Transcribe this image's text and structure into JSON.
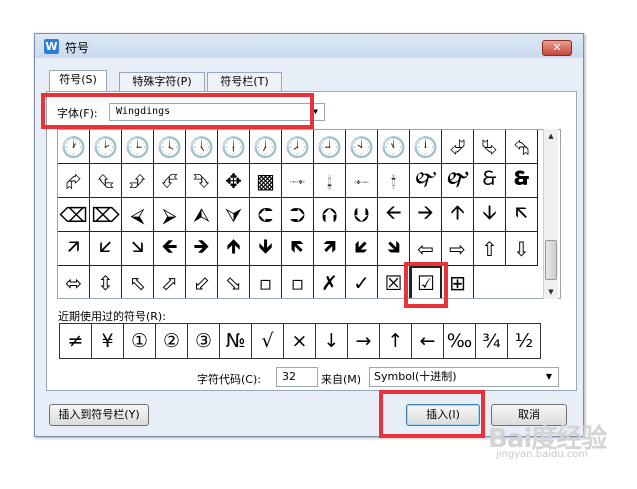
{
  "window": {
    "title": "符号",
    "app_icon": "W",
    "close": "✕"
  },
  "tabs": [
    {
      "label": "符号(S)"
    },
    {
      "label": "特殊字符(P)"
    },
    {
      "label": "符号栏(T)"
    }
  ],
  "font": {
    "label": "字体(F):",
    "value": "Wingdings",
    "arrow": "▼"
  },
  "symbols": [
    "🕐",
    "🕑",
    "🕒",
    "🕓",
    "🕔",
    "🕕",
    "🕖",
    "🕗",
    "🕘",
    "🕙",
    "🕚",
    "🕛",
    "⮰",
    "⮱",
    "⮲",
    "⮳",
    "⮴",
    "⮵",
    "⮶",
    "⮷",
    "✥",
    "▩",
    "🙬",
    "🙭",
    "🙮",
    "🙯",
    "🙰",
    "🙱",
    "🙲",
    "🙳",
    "⌫",
    "⌦",
    "⮘",
    "⮚",
    "⮙",
    "⮛",
    "⮈",
    "⮊",
    "⮉",
    "⮋",
    "🡨",
    "🡪",
    "🡩",
    "🡫",
    "🡬",
    "🡭",
    "🡯",
    "🡮",
    "🡸",
    "🡺",
    "🡹",
    "🡻",
    "🡼",
    "🡽",
    "🡿",
    "🡾",
    "⇦",
    "⇨",
    "⇧",
    "⇩",
    "⬄",
    "⇳",
    "⬁",
    "⬀",
    "⬃",
    "⬂",
    "▫",
    "▫",
    "✗",
    "✓",
    "☒",
    "☑",
    "⊞",
    "",
    ""
  ],
  "recent": {
    "label": "近期使用过的符号(R):",
    "items": [
      "≠",
      "¥",
      "①",
      "②",
      "③",
      "№",
      "√",
      "×",
      "↓",
      "→",
      "↑",
      "←",
      "‰",
      "¾",
      "½"
    ]
  },
  "char_code": {
    "label": "字符代码(C):",
    "value": "32"
  },
  "from": {
    "label": "来自(M)",
    "value": "Symbol(十进制)",
    "arrow": "▼"
  },
  "buttons": {
    "insert_to_bar": "插入到符号栏(Y)",
    "insert": "插入(I)",
    "cancel": "取消"
  },
  "scrollbar": {
    "up": "▲",
    "down": "▼"
  },
  "watermark": {
    "text": "Bai度经验",
    "sub": "jingyan.baidu.com"
  },
  "colors": {
    "highlight": "#e83238",
    "dialog_bg": "#e8eef7"
  }
}
